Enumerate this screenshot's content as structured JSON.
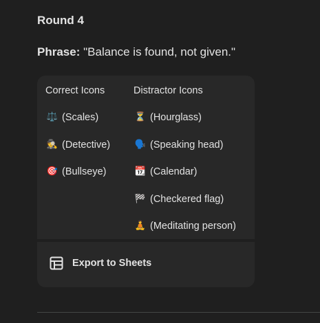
{
  "round": {
    "heading": "Round 4"
  },
  "phrase": {
    "label": "Phrase:",
    "text": "\"Balance is found, not given.\""
  },
  "table": {
    "columns": {
      "correct": "Correct Icons",
      "distractor": "Distractor Icons"
    },
    "correct_icons": [
      {
        "emoji": "⚖️",
        "label": "(Scales)"
      },
      {
        "emoji": "🕵️",
        "label": "(Detective)"
      },
      {
        "emoji": "🎯",
        "label": "(Bullseye)"
      }
    ],
    "distractor_icons": [
      {
        "emoji": "⏳",
        "label": "(Hourglass)"
      },
      {
        "emoji": "🗣️",
        "label": "(Speaking head)"
      },
      {
        "emoji": "📆",
        "label": "(Calendar)"
      },
      {
        "emoji": "🏁",
        "label": "(Checkered flag)"
      },
      {
        "emoji": "🧘",
        "label": "(Meditating person)"
      }
    ]
  },
  "export": {
    "label": "Export to Sheets",
    "icon": "table-grid-icon"
  },
  "colors": {
    "background": "#1f1f1f",
    "card": "#282828",
    "text": "#e3e3e3",
    "divider": "#444746"
  }
}
